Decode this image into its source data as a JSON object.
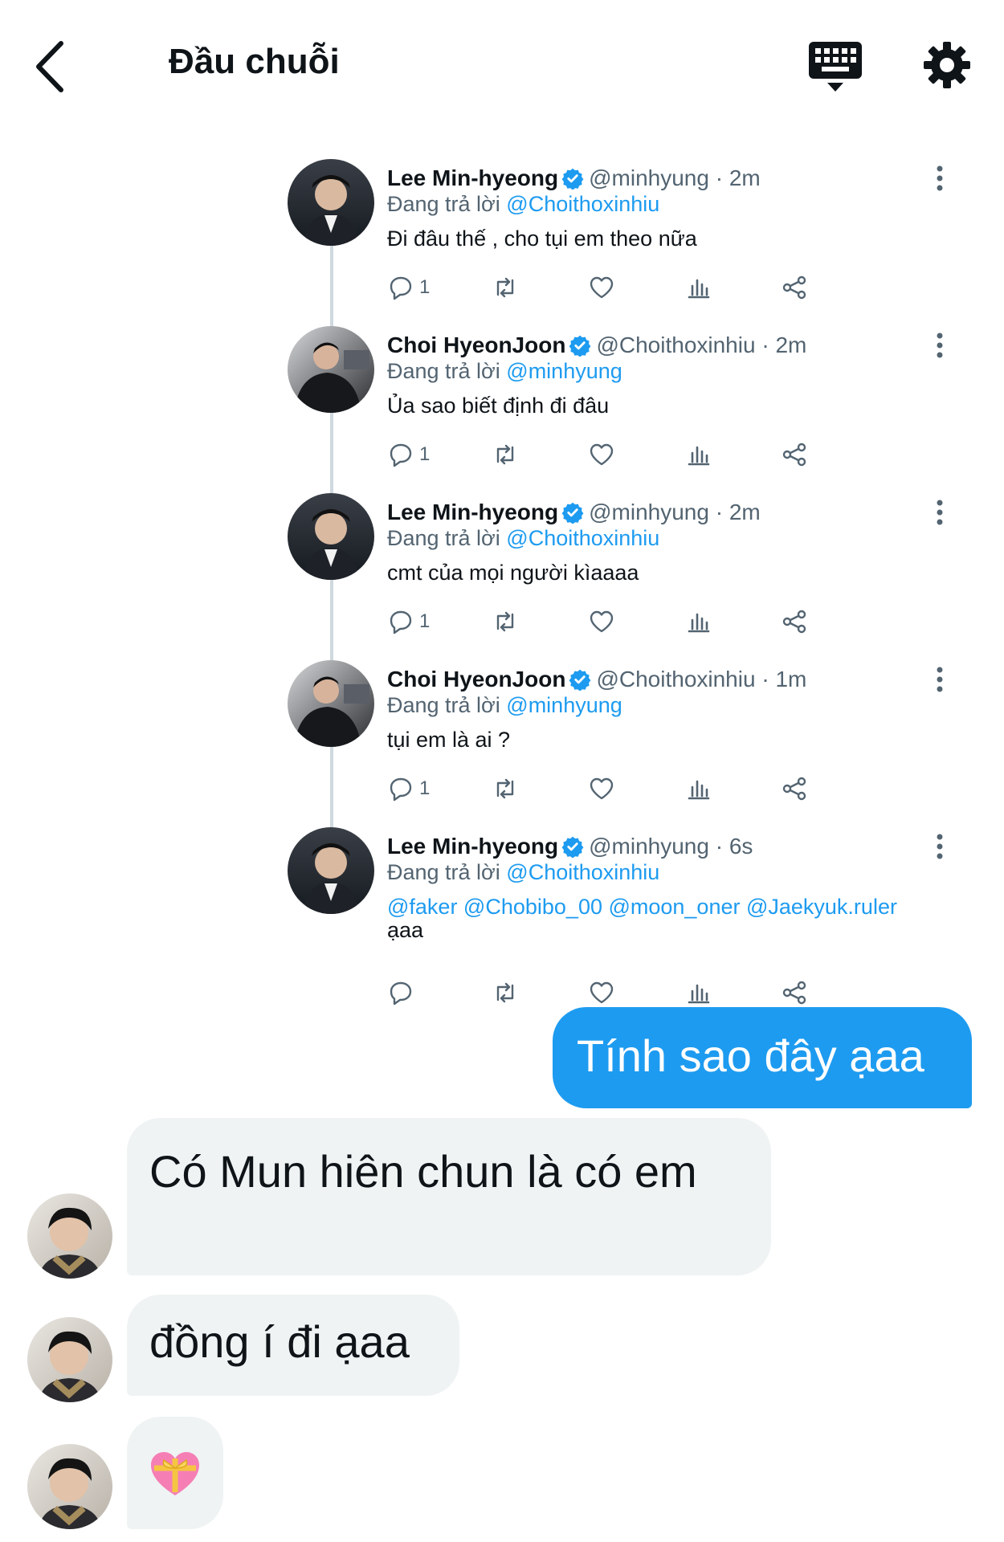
{
  "header": {
    "title": "Đầu chuỗi"
  },
  "tweets": [
    {
      "name": "Lee Min-hyeong",
      "handle": "@minhyung",
      "sep": "·",
      "time": "2m",
      "reply_prefix": "Đang trả lời",
      "reply_to": "@Choithoxinhiu",
      "text": "Đi đâu thế , cho tụi em theo nữa",
      "reply_count": "1",
      "avatar": "lmh"
    },
    {
      "name": "Choi HyeonJoon",
      "handle": "@Choithoxinhiu",
      "sep": "·",
      "time": "2m",
      "reply_prefix": "Đang trả lời",
      "reply_to": "@minhyung",
      "text": "Ủa sao biết định đi đâu",
      "reply_count": "1",
      "avatar": "chj"
    },
    {
      "name": "Lee Min-hyeong",
      "handle": "@minhyung",
      "sep": "·",
      "time": "2m",
      "reply_prefix": "Đang trả lời",
      "reply_to": "@Choithoxinhiu",
      "text": "cmt của mọi người kìaaaa",
      "reply_count": "1",
      "avatar": "lmh"
    },
    {
      "name": "Choi HyeonJoon",
      "handle": "@Choithoxinhiu",
      "sep": "·",
      "time": "1m",
      "reply_prefix": "Đang trả lời",
      "reply_to": "@minhyung",
      "text": "tụi em là ai ?",
      "reply_count": "1",
      "avatar": "chj"
    },
    {
      "name": "Lee Min-hyeong",
      "handle": "@minhyung",
      "sep": "·",
      "time": "6s",
      "reply_prefix": "Đang trả lời",
      "reply_to": "@Choithoxinhiu",
      "mentions": "@faker @Chobibo_00 @moon_oner @Jaekyuk.ruler",
      "text": "ạaa",
      "reply_count": "",
      "avatar": "lmh"
    }
  ],
  "chat": {
    "outgoing": "Tính sao đây ạaa",
    "incoming": [
      {
        "text": "Có Mun hiên chun là có em"
      },
      {
        "text": "đồng í đi ạaa"
      },
      {
        "emoji": "heart-with-ribbon"
      }
    ]
  },
  "colors": {
    "accent": "#1d9bf0",
    "bubble_in": "#eff3f4",
    "secondary_text": "#536471"
  }
}
